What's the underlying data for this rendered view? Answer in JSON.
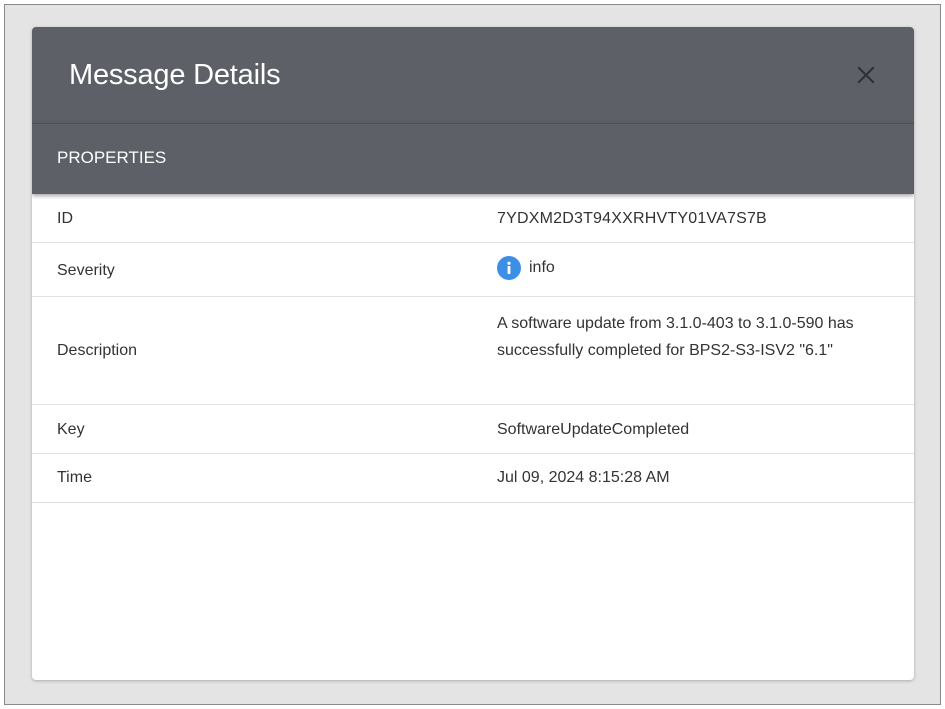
{
  "dialog": {
    "title": "Message Details",
    "close_icon": "close-icon"
  },
  "section": {
    "label": "PROPERTIES"
  },
  "properties": {
    "id": {
      "label": "ID",
      "value": "7YDXM2D3T94XXRHVTY01VA7S7B"
    },
    "severity": {
      "label": "Severity",
      "value": "info",
      "icon": "info-icon",
      "icon_color": "#3d8fe6"
    },
    "description": {
      "label": "Description",
      "value": "A software update from 3.1.0-403 to 3.1.0-590 has successfully completed for BPS2-S3-ISV2 \"6.1\""
    },
    "key": {
      "label": "Key",
      "value": "SoftwareUpdateCompleted"
    },
    "time": {
      "label": "Time",
      "value": "Jul 09, 2024 8:15:28 AM"
    }
  },
  "colors": {
    "header": "#5d6066",
    "backdrop": "#e4e4e4",
    "text": "#333333"
  }
}
